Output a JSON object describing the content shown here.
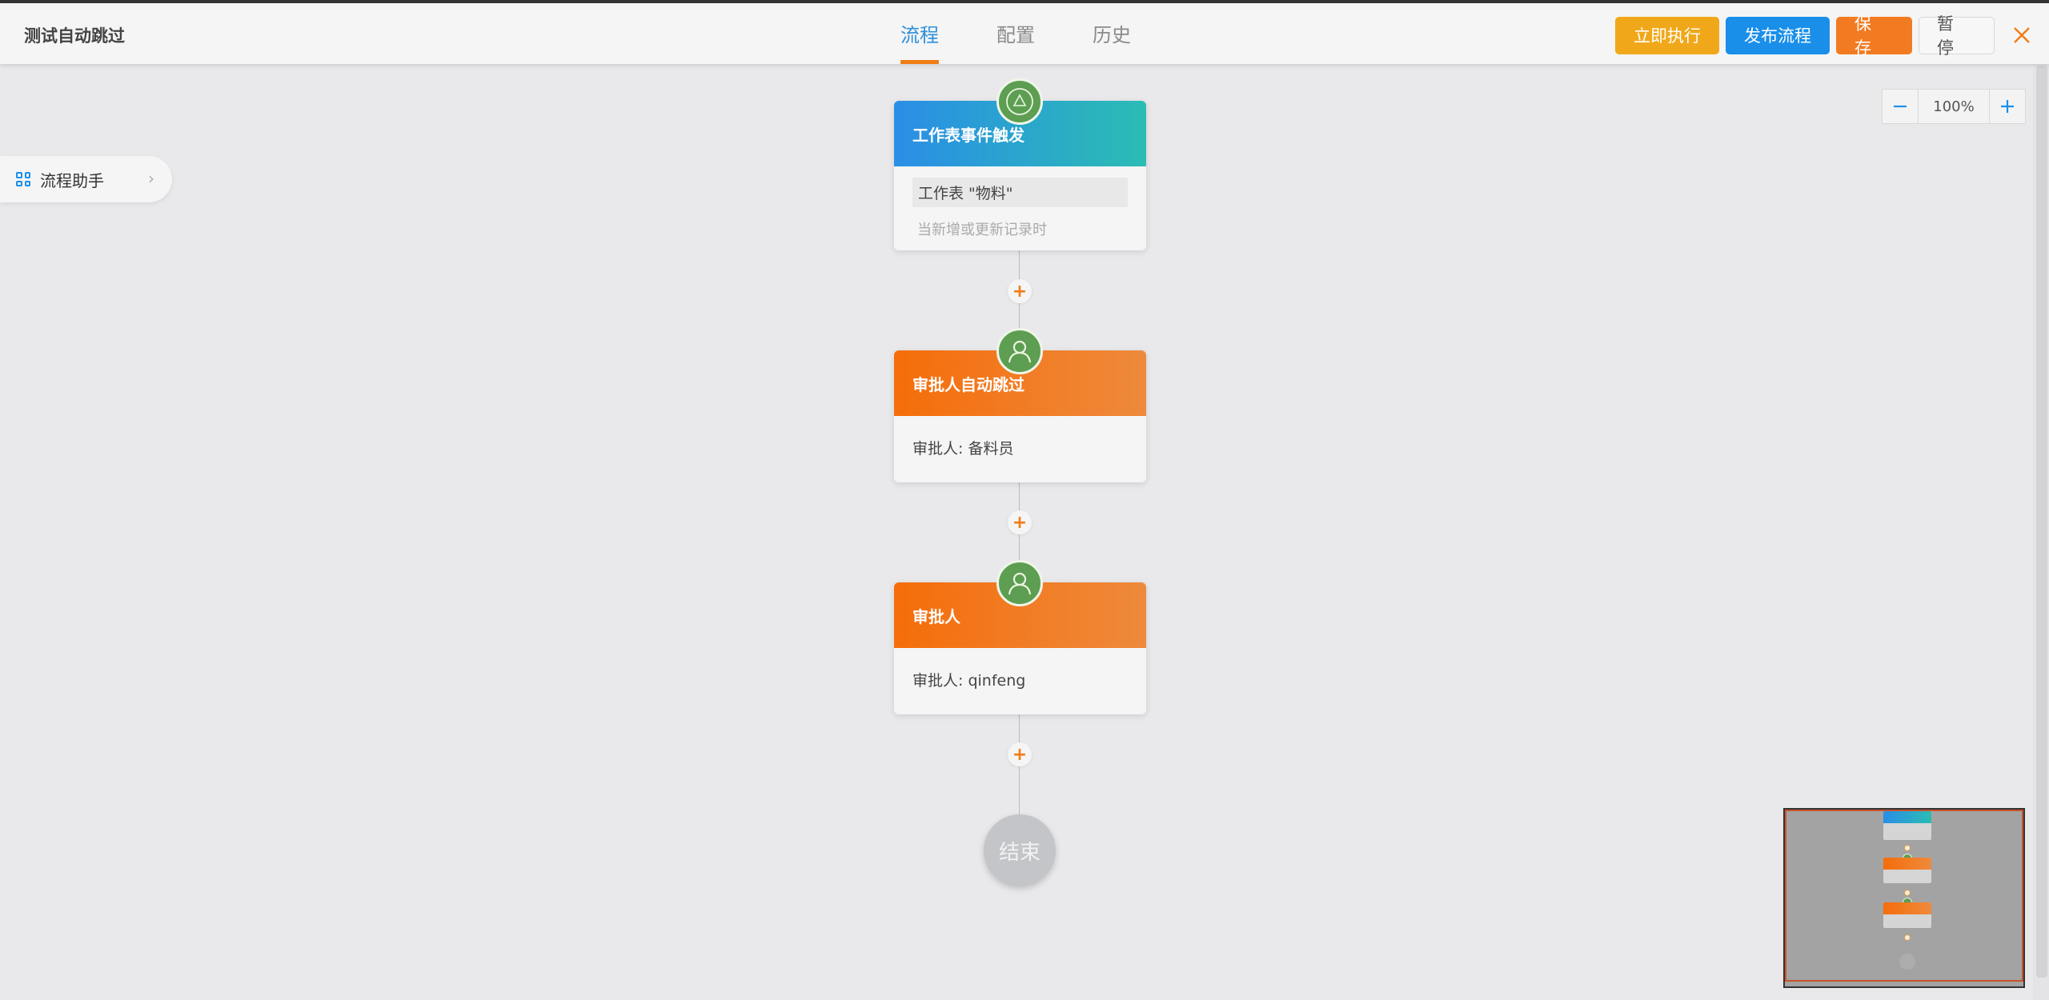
{
  "header": {
    "title": "测试自动跳过",
    "tabs": [
      {
        "label": "流程",
        "active": true
      },
      {
        "label": "配置",
        "active": false
      },
      {
        "label": "历史",
        "active": false
      }
    ],
    "actions": {
      "run_now": "立即执行",
      "publish": "发布流程",
      "save": "保存",
      "pause": "暂停"
    },
    "close_icon": "close-icon"
  },
  "zoom": {
    "minus": "−",
    "value": "100%",
    "plus": "+"
  },
  "assistant": {
    "label": "流程助手",
    "icon": "grid-icon",
    "chevron": "›"
  },
  "flow": {
    "nodes": [
      {
        "type": "trigger",
        "title": "工作表事件触发",
        "sheet": "工作表 \"物料\"",
        "description": "当新增或更新记录时",
        "icon": "trigger-icon"
      },
      {
        "type": "approver",
        "title": "审批人自动跳过",
        "detail": "审批人: 备料员",
        "icon": "user-icon"
      },
      {
        "type": "approver",
        "title": "审批人",
        "detail": "审批人: qinfeng",
        "icon": "user-icon"
      }
    ],
    "add_label": "+",
    "end_label": "结束"
  },
  "colors": {
    "accent_orange": "#f07c14",
    "accent_blue": "#1a8fea",
    "run_button": "#f0a81a",
    "badge_green": "#5d9e52"
  }
}
